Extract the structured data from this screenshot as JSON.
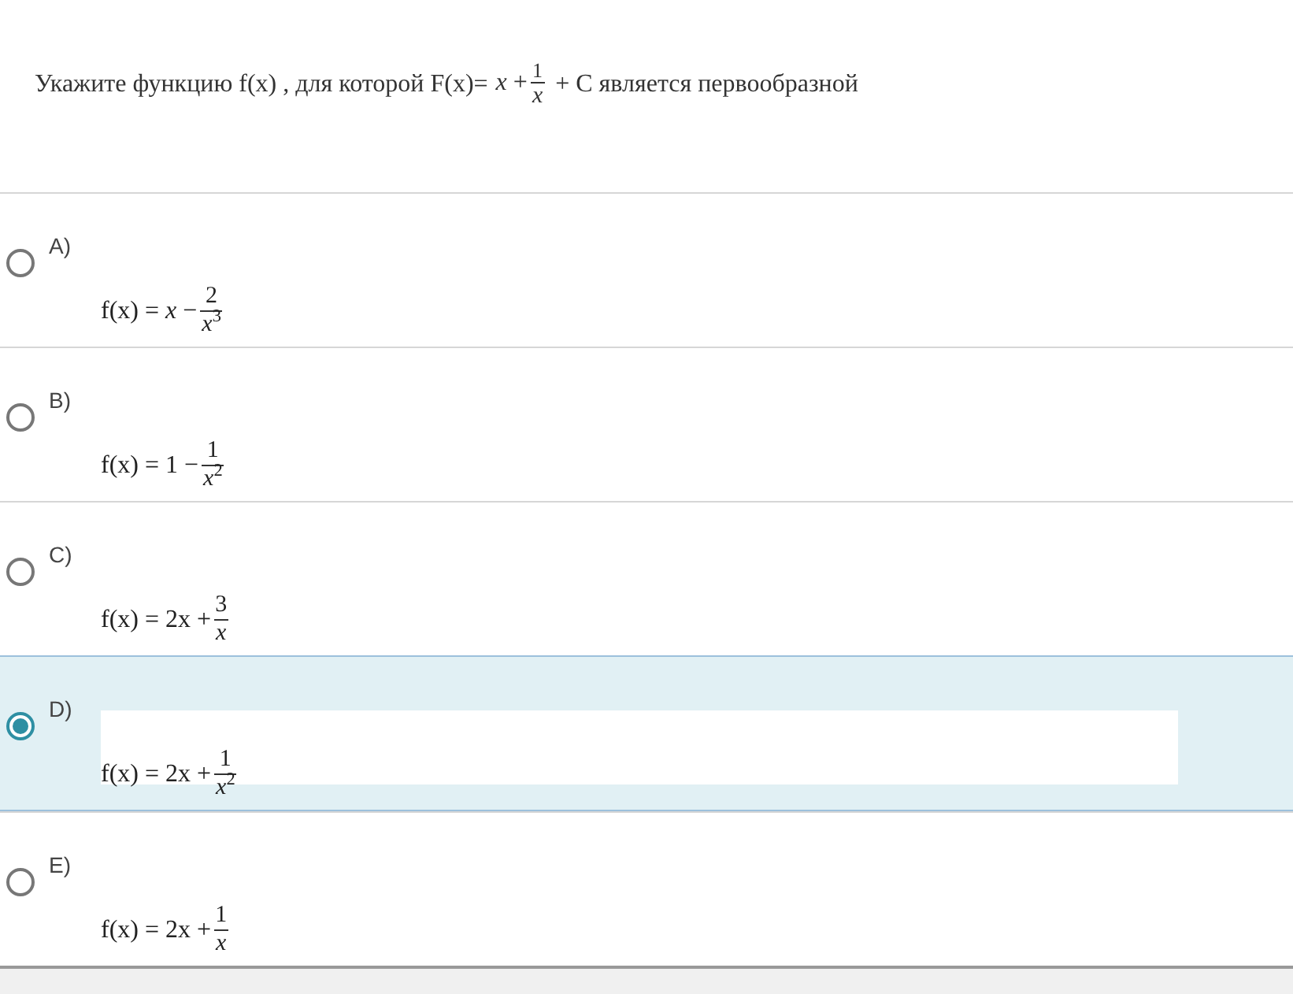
{
  "question": {
    "before": "Укажите функцию f(x) , для которой F(x)=",
    "formula": {
      "lead": "*x* +",
      "numerator": "1",
      "denominator": "*x*"
    },
    "after": "+ C является первообразной"
  },
  "options": [
    {
      "label": "A)",
      "selected": false,
      "formula": {
        "lead": "f(x) = *x* −",
        "numerator": "2",
        "denominator": "*x*$^{3}$"
      }
    },
    {
      "label": "B)",
      "selected": false,
      "formula": {
        "lead": "f(x) = 1 −",
        "numerator": "1",
        "denominator": "*x*$^{2}$"
      }
    },
    {
      "label": "C)",
      "selected": false,
      "formula": {
        "lead": "f(x) = 2x +",
        "numerator": "3",
        "denominator": "*x*"
      }
    },
    {
      "label": "D)",
      "selected": true,
      "formula": {
        "lead": "f(x) = 2x +",
        "numerator": "1",
        "denominator": "*x*$^{2}$"
      }
    },
    {
      "label": "E)",
      "selected": false,
      "formula": {
        "lead": "f(x) = 2x +",
        "numerator": "1",
        "denominator": "*x*"
      }
    }
  ]
}
